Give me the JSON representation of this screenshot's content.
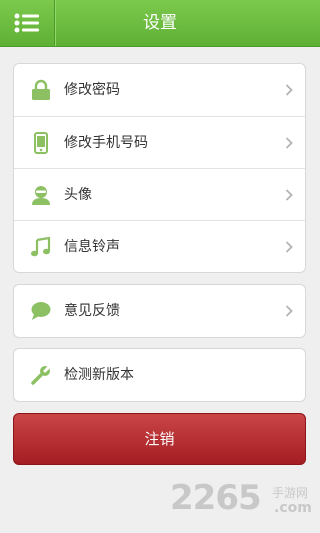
{
  "header": {
    "title": "设置",
    "menu_icon": "list-menu-icon"
  },
  "groups": [
    {
      "items": [
        {
          "label": "修改密码",
          "icon": "lock-icon"
        },
        {
          "label": "修改手机号码",
          "icon": "phone-icon"
        },
        {
          "label": "头像",
          "icon": "avatar-icon"
        },
        {
          "label": "信息铃声",
          "icon": "music-note-icon"
        }
      ]
    },
    {
      "items": [
        {
          "label": "意见反馈",
          "icon": "speech-bubble-icon"
        }
      ]
    },
    {
      "items": [
        {
          "label": "检测新版本",
          "icon": "wrench-icon"
        }
      ]
    }
  ],
  "logout": {
    "label": "注销"
  },
  "watermark": {
    "number": "2265",
    "site": "手游网",
    "domain": ".com"
  },
  "colors": {
    "header_green": "#6cbc40",
    "logout_red": "#b42b30",
    "icon_green": "#8cc063",
    "text": "#333333"
  }
}
